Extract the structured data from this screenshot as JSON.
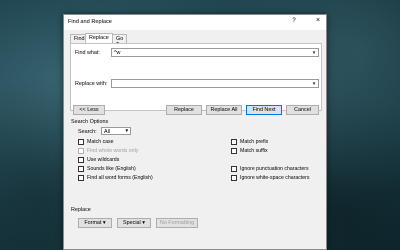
{
  "dialog": {
    "title": "Find and Replace",
    "help": "?",
    "close": "×"
  },
  "tabs": [
    {
      "label": "Find",
      "active": false
    },
    {
      "label": "Replace",
      "active": true
    },
    {
      "label": "Go To",
      "active": false
    }
  ],
  "find": {
    "label": "Find what:",
    "value": "^w"
  },
  "replace": {
    "label": "Replace with:",
    "value": ""
  },
  "buttons": {
    "less": "<< Less",
    "replace": "Replace",
    "replace_all": "Replace All",
    "find_next": "Find Next",
    "cancel": "Cancel"
  },
  "search_options": {
    "heading": "Search Options",
    "search_label": "Search:",
    "search_value": "All",
    "left": [
      {
        "label": "Match case",
        "disabled": false
      },
      {
        "label": "Find whole words only",
        "disabled": true
      },
      {
        "label": "Use wildcards",
        "disabled": false
      },
      {
        "label": "Sounds like (English)",
        "disabled": false
      },
      {
        "label": "Find all word forms (English)",
        "disabled": false
      }
    ],
    "right": [
      {
        "label": "Match prefix",
        "disabled": false
      },
      {
        "label": "Match suffix",
        "disabled": false
      },
      {
        "label": "Ignore punctuation characters",
        "disabled": false
      },
      {
        "label": "Ignore white-space characters",
        "disabled": false
      }
    ]
  },
  "replace_section": {
    "heading": "Replace",
    "format": "Format ▾",
    "special": "Special ▾",
    "no_formatting": "No Formatting"
  },
  "icons": {
    "dropdown": "chevron-down-icon"
  }
}
